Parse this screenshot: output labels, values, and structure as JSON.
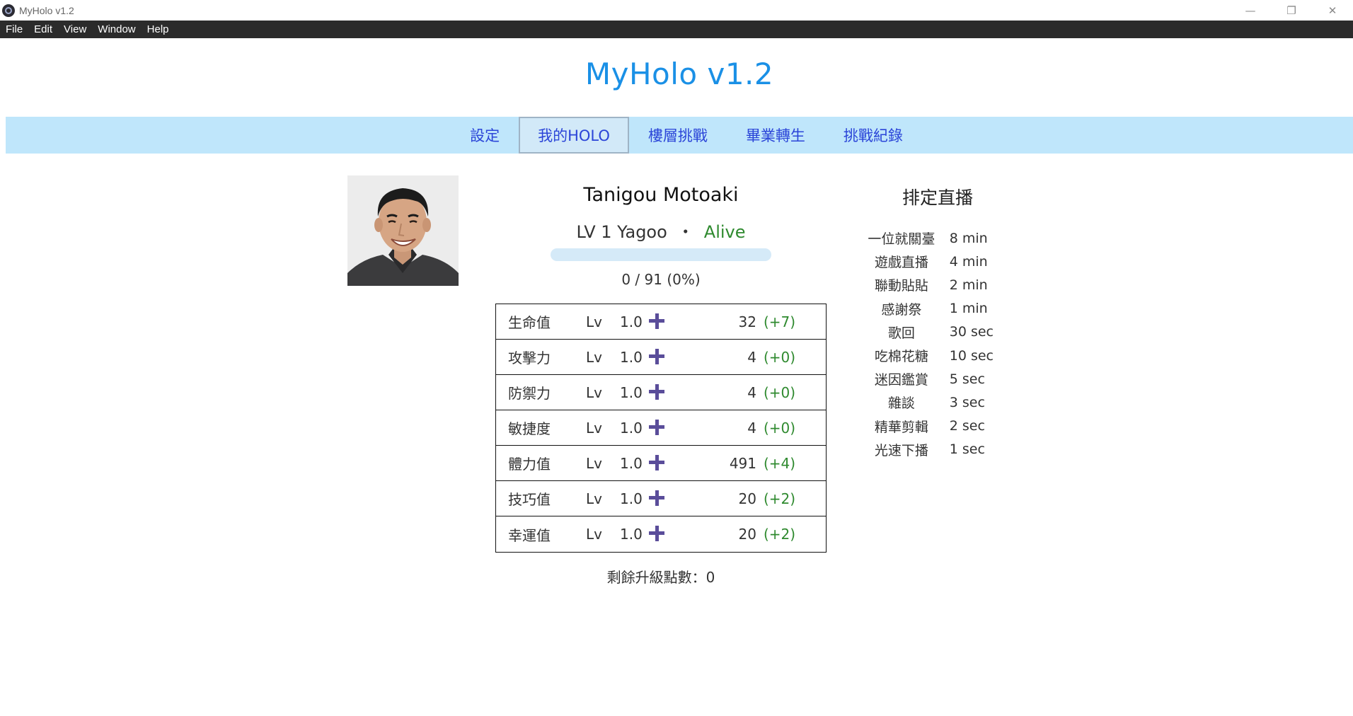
{
  "window": {
    "title": "MyHolo v1.2",
    "controls": [
      "—",
      "❐",
      "✕"
    ]
  },
  "menu": [
    "File",
    "Edit",
    "View",
    "Window",
    "Help"
  ],
  "app_title": "MyHolo v1.2",
  "nav": {
    "tabs": [
      "設定",
      "我的HOLO",
      "樓層挑戰",
      "畢業轉生",
      "挑戰紀錄"
    ],
    "active": "我的HOLO"
  },
  "profile": {
    "name": "Tanigou Motoaki",
    "level_text": "LV 1 Yagoo",
    "separator": "・",
    "status": "Alive",
    "xp_text": "0 / 91 (0%)",
    "xp_fraction": 0
  },
  "stats": [
    {
      "name": "生命值",
      "lv_label": "Lv",
      "lv": "1.0",
      "value": "32",
      "bonus": "(+7)"
    },
    {
      "name": "攻擊力",
      "lv_label": "Lv",
      "lv": "1.0",
      "value": "4",
      "bonus": "(+0)"
    },
    {
      "name": "防禦力",
      "lv_label": "Lv",
      "lv": "1.0",
      "value": "4",
      "bonus": "(+0)"
    },
    {
      "name": "敏捷度",
      "lv_label": "Lv",
      "lv": "1.0",
      "value": "4",
      "bonus": "(+0)"
    },
    {
      "name": "體力值",
      "lv_label": "Lv",
      "lv": "1.0",
      "value": "491",
      "bonus": "(+4)"
    },
    {
      "name": "技巧值",
      "lv_label": "Lv",
      "lv": "1.0",
      "value": "20",
      "bonus": "(+2)"
    },
    {
      "name": "幸運值",
      "lv_label": "Lv",
      "lv": "1.0",
      "value": "20",
      "bonus": "(+2)"
    }
  ],
  "remaining_points": "剩餘升級點數：0",
  "schedule": {
    "title": "排定直播",
    "items": [
      {
        "label": "一位就關臺",
        "duration": "8 min"
      },
      {
        "label": "遊戲直播",
        "duration": "4 min"
      },
      {
        "label": "聯動貼貼",
        "duration": "2 min"
      },
      {
        "label": "感謝祭",
        "duration": "1 min"
      },
      {
        "label": "歌回",
        "duration": "30 sec"
      },
      {
        "label": "吃棉花糖",
        "duration": "10 sec"
      },
      {
        "label": "迷因鑑賞",
        "duration": "5 sec"
      },
      {
        "label": "雜談",
        "duration": "3 sec"
      },
      {
        "label": "精華剪輯",
        "duration": "2 sec"
      },
      {
        "label": "光速下播",
        "duration": "1 sec"
      }
    ]
  },
  "colors": {
    "title": "#1a90e6",
    "nav_bg": "#bfe6fb",
    "nav_text": "#2b45d8",
    "alive": "#2f8a2f",
    "bonus": "#2f8a2f",
    "plus_icon": "#5a4d9a",
    "menubar_bg": "#2b2b2b"
  }
}
